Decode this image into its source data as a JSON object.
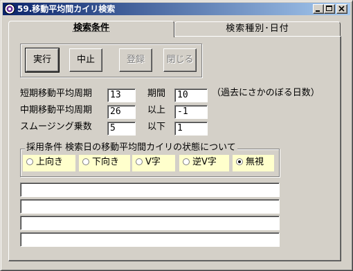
{
  "window": {
    "title": "59.移動平均間カイリ検索"
  },
  "tabs": [
    {
      "label": "検索条件"
    },
    {
      "label": "検索種別･日付"
    }
  ],
  "buttons": {
    "run": "実行",
    "stop": "中止",
    "register": "登録",
    "close": "閉じる"
  },
  "params": {
    "short_label": "短期移動平均周期",
    "short_value": "13",
    "mid_label": "中期移動平均周期",
    "mid_value": "26",
    "smoothing_label": "スムージング乗数",
    "smoothing_value": "5",
    "period_label": "期間",
    "period_value": "10",
    "period_note": "（過去にさかのぼる日数）",
    "above_label": "以上",
    "above_value": "-1",
    "below_label": "以下",
    "below_value": "1"
  },
  "condition": {
    "title": "採用条件  検索日の移動平均間カイリの状態について",
    "options": [
      "上向き",
      "下向き",
      "V字",
      "逆V字",
      "無視"
    ],
    "selected": "無視"
  },
  "outputs": [
    "",
    "",
    "",
    ""
  ]
}
